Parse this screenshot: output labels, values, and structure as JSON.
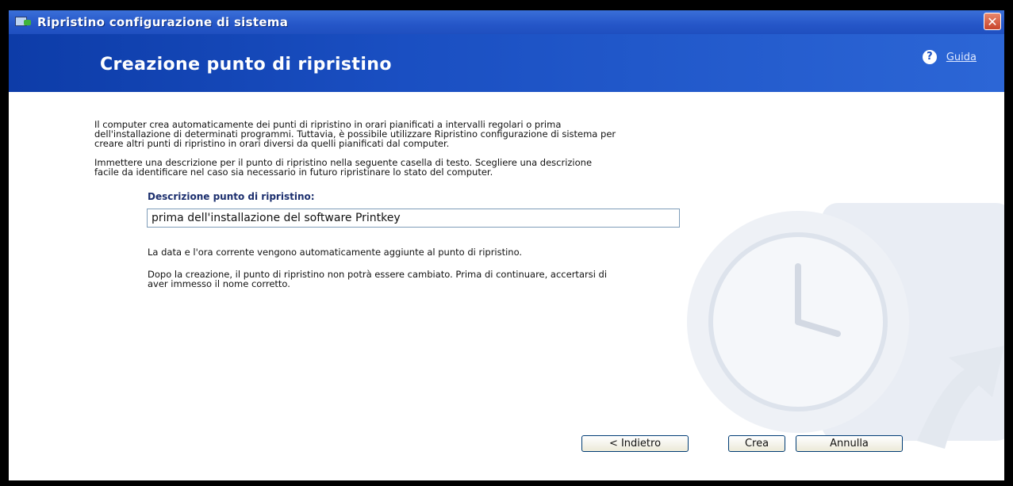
{
  "window": {
    "title": "Ripristino configurazione di sistema",
    "close_glyph": "✕"
  },
  "header": {
    "title": "Creazione punto di ripristino",
    "help_icon": "?",
    "help_label": "Guida"
  },
  "content": {
    "intro_1_line1": "Il computer crea automaticamente dei punti di ripristino in orari pianificati a intervalli regolari o prima",
    "intro_1_line2": "dell'installazione di determinati programmi. Tuttavia, è possibile utilizzare Ripristino configurazione di sistema per",
    "intro_1_line3": "creare altri punti di ripristino in orari diversi da quelli pianificati dal computer.",
    "intro_2_line1": "Immettere una descrizione per il punto di ripristino nella seguente casella di testo. Scegliere una descrizione",
    "intro_2_line2": "facile da identificare nel caso sia necessario in futuro ripristinare lo stato del computer.",
    "field_label": "Descrizione punto di ripristino:",
    "field_value": "prima dell'installazione del software Printkey",
    "note_1": "La data e l'ora corrente vengono automaticamente aggiunte al punto di ripristino.",
    "note_2_line1": "Dopo la creazione, il punto di ripristino non potrà essere cambiato. Prima di continuare, accertarsi di",
    "note_2_line2": "aver immesso il nome corretto."
  },
  "buttons": {
    "back": "< Indietro",
    "create": "Crea",
    "cancel": "Annulla"
  },
  "colors": {
    "title_bar": "#2556c8",
    "header_bg": "#1a4fc2",
    "field_label": "#1c2f6e"
  }
}
